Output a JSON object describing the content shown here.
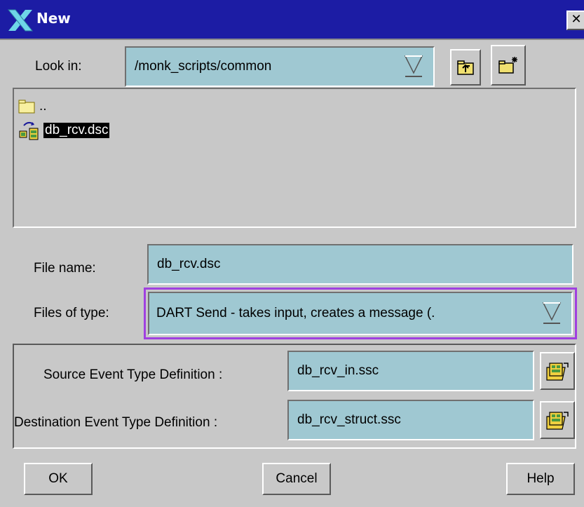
{
  "window": {
    "title": "New",
    "close_glyph": "✕"
  },
  "look_in": {
    "label": "Look in:",
    "value": "/monk_scripts/common",
    "up_icon": "folder-up-icon",
    "new_folder_icon": "new-folder-icon"
  },
  "file_list": {
    "items": [
      {
        "name": "..",
        "icon": "folder-icon"
      },
      {
        "name": "db_rcv.dsc",
        "icon": "collaboration-script-icon",
        "selected": true
      }
    ]
  },
  "file_name": {
    "label": "File name:",
    "value": "db_rcv.dsc"
  },
  "file_type": {
    "label": "Files of type:",
    "value": "DART Send - takes input, creates a message (."
  },
  "event_types": {
    "source_label": "Source Event Type Definition :",
    "source_value": "db_rcv_in.ssc",
    "destination_label": "Destination Event Type Definition :",
    "destination_value": "db_rcv_struct.ssc",
    "browse_icon": "browse-etd-icon"
  },
  "buttons": {
    "ok": "OK",
    "cancel": "Cancel",
    "help": "Help"
  },
  "colors": {
    "titlebar": "#1c1ca4",
    "field": "#9fc8d2",
    "focus_border": "#a040e0",
    "selection": "#000000"
  }
}
